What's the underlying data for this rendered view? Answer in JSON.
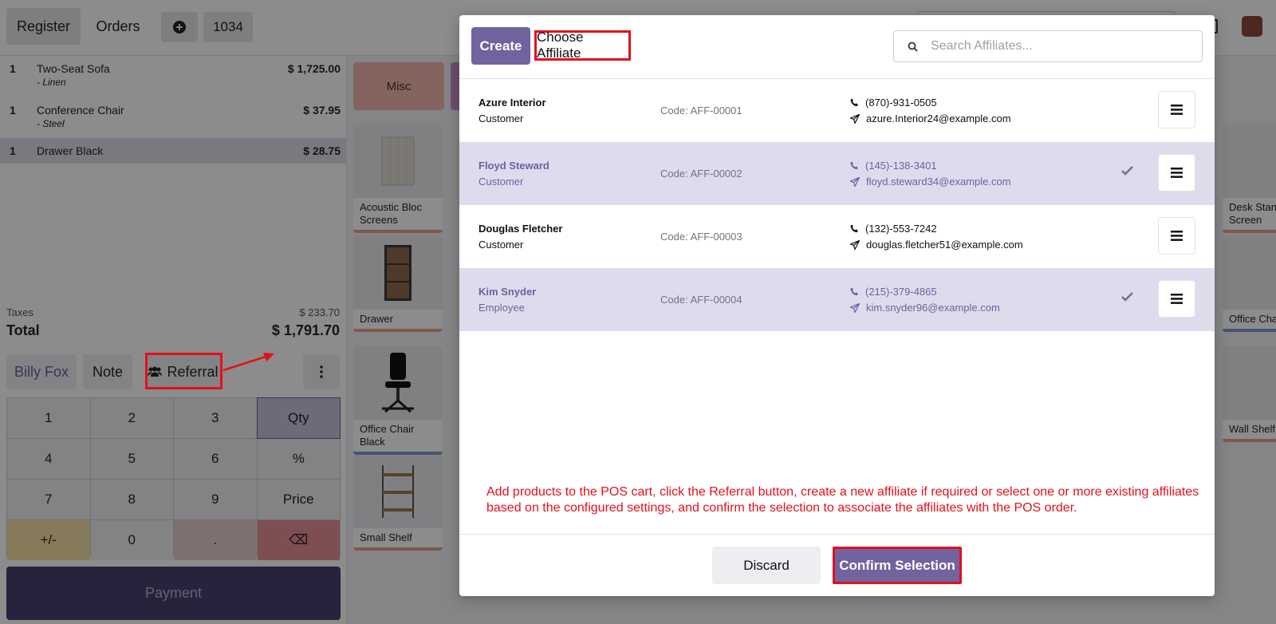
{
  "topbar": {
    "register_label": "Register",
    "orders_label": "Orders",
    "new_order_icon": "plus-circle-icon",
    "order_number": "1034"
  },
  "order_lines": [
    {
      "qty": "1",
      "name": "Two-Seat Sofa",
      "attribute": "- Linen",
      "price": "$ 1,725.00"
    },
    {
      "qty": "1",
      "name": "Conference Chair",
      "attribute": "- Steel",
      "price": "$ 37.95"
    },
    {
      "qty": "1",
      "name": "Drawer Black",
      "attribute": "",
      "price": "$ 28.75",
      "selected": true
    }
  ],
  "summary": {
    "taxes_label": "Taxes",
    "taxes_value": "$ 233.70",
    "total_label": "Total",
    "total_value": "$ 1,791.70"
  },
  "controls": {
    "customer_label": "Billy Fox",
    "note_label": "Note",
    "referral_label": "Referral"
  },
  "numpad": [
    "1",
    "2",
    "3",
    "Qty",
    "4",
    "5",
    "6",
    "%",
    "7",
    "8",
    "9",
    "Price",
    "+/-",
    "0",
    ".",
    "⌫"
  ],
  "payment_label": "Payment",
  "categories": [
    {
      "label": "Misc"
    }
  ],
  "products": [
    {
      "label": "Acoustic Bloc Screens"
    },
    {
      "label": "Drawer"
    },
    {
      "label": "Office Chair Black"
    },
    {
      "label": "Small Shelf"
    },
    {
      "label": "Desk Stand with Screen"
    },
    {
      "label": "Office Chair"
    },
    {
      "label": "Wall Shelf"
    }
  ],
  "modal": {
    "create_label": "Create",
    "title": "Choose Affiliate",
    "search_placeholder": "Search Affiliates...",
    "affiliates": [
      {
        "name": "Azure Interior",
        "role": "Customer",
        "code": "Code: AFF-00001",
        "phone": "(870)-931-0505",
        "email": "azure.Interior24@example.com",
        "selected": false
      },
      {
        "name": "Floyd Steward",
        "role": "Customer",
        "code": "Code: AFF-00002",
        "phone": "(145)-138-3401",
        "email": "floyd.steward34@example.com",
        "selected": true
      },
      {
        "name": "Douglas Fletcher",
        "role": "Customer",
        "code": "Code: AFF-00003",
        "phone": "(132)-553-7242",
        "email": "douglas.fletcher51@example.com",
        "selected": false
      },
      {
        "name": "Kim Snyder",
        "role": "Employee",
        "code": "Code: AFF-00004",
        "phone": "(215)-379-4865",
        "email": "kim.snyder96@example.com",
        "selected": true
      }
    ],
    "instruction": "Add products to the POS cart, click the Referral button, create a new affiliate if required or select one or more existing affiliates based on the configured settings, and confirm the selection to associate the affiliates with the POS order.",
    "discard_label": "Discard",
    "confirm_label": "Confirm Selection"
  },
  "colors": {
    "accent": "#71639e",
    "highlight": "#e3101c",
    "selected_row": "#dedcec"
  }
}
